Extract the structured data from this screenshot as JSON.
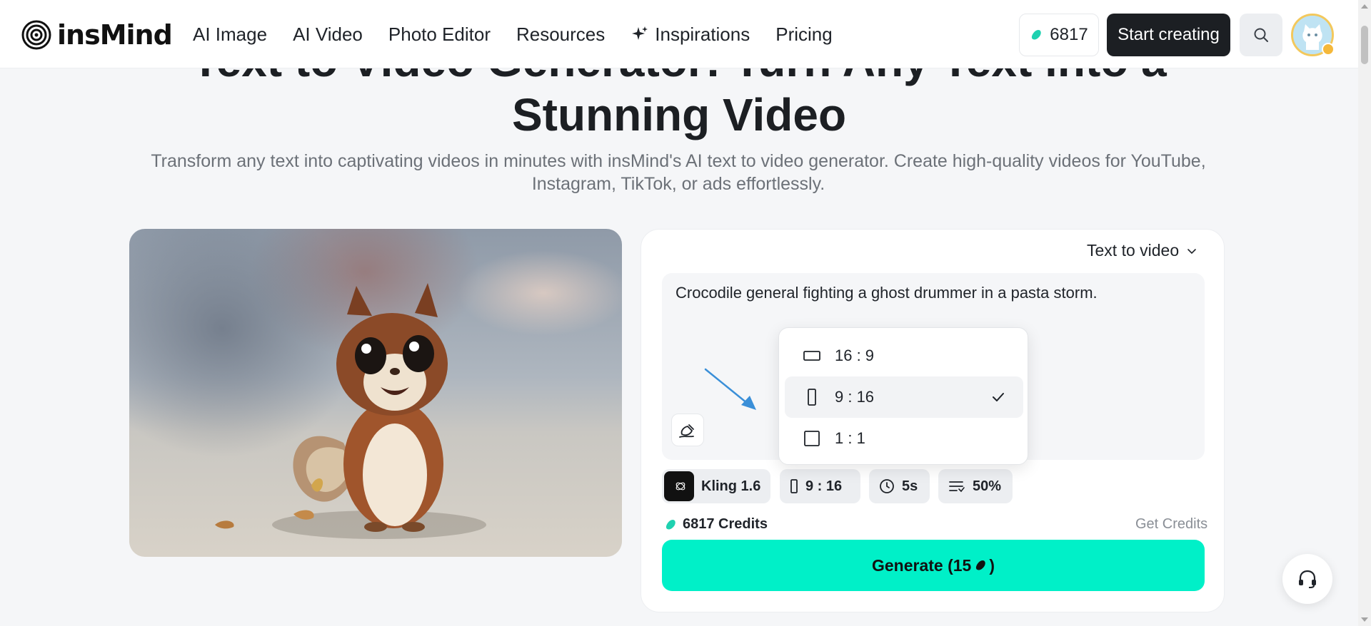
{
  "brand": {
    "name": "insMind"
  },
  "nav": {
    "items": [
      {
        "label": "AI Image"
      },
      {
        "label": "AI Video"
      },
      {
        "label": "Photo Editor"
      },
      {
        "label": "Resources"
      },
      {
        "label": "Inspirations",
        "icon": "sparkle-icon"
      },
      {
        "label": "Pricing"
      }
    ]
  },
  "header": {
    "credits": "6817",
    "start_label": "Start creating",
    "search_icon": "search-icon"
  },
  "hero": {
    "title_line1": "Text to Video Generator: Turn Any Text into a",
    "title_line2": "Stunning Video",
    "subtitle": "Transform any text into captivating videos in minutes with insMind's AI text to video generator. Create high-quality videos for YouTube, Instagram, TikTok, or ads effortlessly."
  },
  "panel": {
    "mode": "Text to video",
    "prompt": "Crocodile general fighting a ghost drummer in a pasta storm.",
    "ratio_menu": {
      "options": [
        {
          "label": "16 : 9",
          "icon": "landscape-icon"
        },
        {
          "label": "9 : 16",
          "icon": "portrait-icon",
          "selected": true
        },
        {
          "label": "1 : 1",
          "icon": "square-icon"
        }
      ]
    },
    "chips": {
      "model": "Kling 1.6",
      "ratio": "9 : 16",
      "duration": "5s",
      "quality": "50%"
    },
    "credits_label": "6817 Credits",
    "get_credits": "Get Credits",
    "generate_prefix": "Generate (15",
    "generate_suffix": ")"
  },
  "colors": {
    "accent": "#00f0c8",
    "dark_button": "#1c1f23",
    "credit_drop": "#1fd1b0"
  }
}
